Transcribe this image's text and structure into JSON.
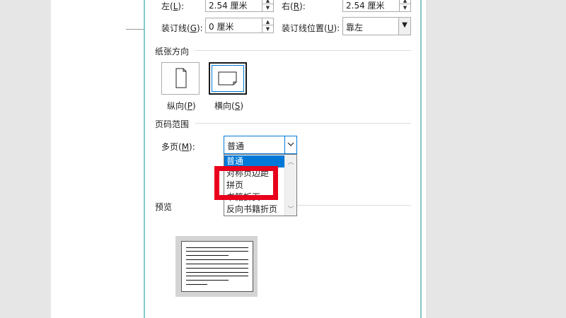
{
  "margins": {
    "left_label": "左(",
    "left_key": "L",
    "left_suffix": "):",
    "left_value": "2.54 厘米",
    "right_label": "右(",
    "right_key": "R",
    "right_suffix": "):",
    "right_value": "2.54 厘米",
    "gutter_label": "装订线(",
    "gutter_key": "G",
    "gutter_suffix": "):",
    "gutter_value": "0 厘米",
    "gutter_pos_label": "装订线位置(",
    "gutter_pos_key": "U",
    "gutter_pos_suffix": "):",
    "gutter_pos_value": "靠左"
  },
  "orientation": {
    "title": "纸张方向",
    "portrait_label": "纵向(",
    "portrait_key": "P",
    "portrait_suffix": ")",
    "landscape_label": "横向(",
    "landscape_key": "S",
    "landscape_suffix": ")",
    "selected": "landscape"
  },
  "pages": {
    "title": "页码范围",
    "multi_label": "多页(",
    "multi_key": "M",
    "multi_suffix": "):",
    "multi_value": "普通",
    "options": [
      "普通",
      "对称页边距",
      "拼页",
      "书籍折页",
      "反向书籍折页"
    ],
    "selected_option": "普通"
  },
  "preview": {
    "title": "预览"
  },
  "icons": {
    "spin_up": "spin-up-icon",
    "spin_down": "spin-down-icon",
    "combo_arrow": "chevron-down-icon",
    "scroll_up": "scroll-up-icon",
    "scroll_down": "scroll-down-icon"
  },
  "colors": {
    "selection": "#0078d7",
    "highlight": "#e8001c",
    "dialog_border": "#86c7c8"
  }
}
